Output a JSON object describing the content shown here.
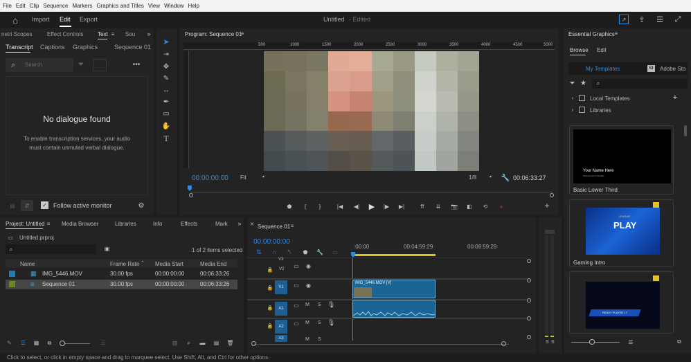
{
  "menu": [
    "File",
    "Edit",
    "Clip",
    "Sequence",
    "Markers",
    "Graphics and Titles",
    "View",
    "Window",
    "Help"
  ],
  "workspace": {
    "import": "Import",
    "edit": "Edit",
    "export": "Export",
    "title": "Untitled",
    "edited": "- Edited"
  },
  "left_tabs": {
    "lumetri": "netri Scopes",
    "effect_controls": "Effect Controls",
    "text": "Text",
    "source": "Sou"
  },
  "text_subtabs": {
    "transcript": "Transcript",
    "captions": "Captions",
    "graphics": "Graphics",
    "sequence": "Sequence 01"
  },
  "search_placeholder": "Search",
  "no_dialogue": "No dialogue found",
  "no_dialogue_desc": "To enable transcription services, your audio must contain unmuted verbal dialogue.",
  "follow_monitor": "Follow active monitor",
  "program": {
    "title": "Program: Sequence 01",
    "timecode": "00:00:00:00",
    "fit": "Fit",
    "ratio": "1/8",
    "duration": "00:06:33:27",
    "ruler": [
      "500",
      "1000",
      "1500",
      "2000",
      "2500",
      "3000",
      "3500",
      "4000",
      "4500",
      "5000"
    ]
  },
  "essential": {
    "title": "Essential Graphics",
    "browse": "Browse",
    "edit": "Edit",
    "my_templates": "My Templates",
    "adobe_stock": "Adobe Sto",
    "local": "Local Templates",
    "libraries": "Libraries",
    "templates": [
      {
        "name": "Basic Lower Third",
        "line1": "Your Name Here",
        "line2": "Second Line is Smaller"
      },
      {
        "name": "Gaming Intro",
        "word": "PLAY",
        "sub": "LEAGUE"
      },
      {
        "name": "",
        "word": "READY PLAYER 1?"
      }
    ]
  },
  "project": {
    "tab": "Project: Untitled",
    "media_browser": "Media Browser",
    "libraries": "Libraries",
    "info": "Info",
    "effects": "Effects",
    "markers": "Mark",
    "file": "Untitled.prproj",
    "count": "1 of 2 items selected",
    "headers": [
      "Name",
      "Frame Rate",
      "Media Start",
      "Media End"
    ],
    "rows": [
      {
        "name": "IMG_5446.MOV",
        "rate": "30.00 fps",
        "start": "00:00:00:00",
        "end": "00:06:33:26",
        "color": "#1e7ab8"
      },
      {
        "name": "Sequence 01",
        "rate": "30.00 fps",
        "start": "00:00:00:00",
        "end": "00:06:33:26",
        "color": "#6b8a1e"
      }
    ]
  },
  "timeline": {
    "title": "Sequence 01",
    "timecode": "00:00:00:00",
    "ticks": [
      ":00:00",
      "00:04:59:29",
      "00:09:59:29"
    ],
    "tracks": [
      "V3",
      "V2",
      "V1",
      "A1",
      "A2",
      "A3"
    ],
    "clip": "IMG_5446.MOV [V]"
  },
  "status": "Click to select, or click in empty space and drag to marquee select. Use Shift, Alt, and Ctrl for other options.",
  "meter": [
    "S",
    "S"
  ]
}
